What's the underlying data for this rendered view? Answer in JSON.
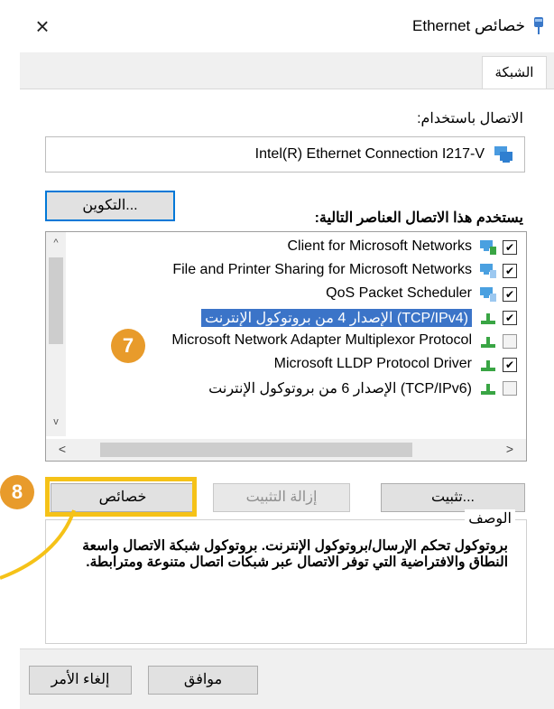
{
  "window": {
    "title": "خصائص Ethernet",
    "close_glyph": "×"
  },
  "tabs": [
    {
      "label": "الشبكة"
    }
  ],
  "connect": {
    "label": "الاتصال باستخدام:",
    "adapter_name": "Intel(R) Ethernet Connection I217-V",
    "configure_button": "التكوين..."
  },
  "items_label": "يستخدم هذا الاتصال العناصر التالية:",
  "items": [
    {
      "label": "Client for Microsoft Networks",
      "checked": true,
      "check_glyph": "✔",
      "icon": "network-client-icon"
    },
    {
      "label": "File and Printer Sharing for Microsoft Networks",
      "checked": true,
      "check_glyph": "✔",
      "icon": "network-service-icon"
    },
    {
      "label": "QoS Packet Scheduler",
      "checked": true,
      "check_glyph": "✔",
      "icon": "network-service-icon"
    },
    {
      "label": "(TCP/IPv4) الإصدار 4 من بروتوكول الإنترنت",
      "checked": true,
      "check_glyph": "✔",
      "icon": "protocol-icon",
      "selected": true
    },
    {
      "label": "Microsoft Network Adapter Multiplexor Protocol",
      "checked": false,
      "check_glyph": "",
      "icon": "protocol-icon"
    },
    {
      "label": "Microsoft LLDP Protocol Driver",
      "checked": true,
      "check_glyph": "✔",
      "icon": "protocol-icon"
    },
    {
      "label": "(TCP/IPv6) الإصدار 6 من بروتوكول الإنترنت",
      "checked": false,
      "check_glyph": "",
      "icon": "protocol-icon"
    }
  ],
  "list_scroll": {
    "up": "^",
    "down": "v",
    "left": "<",
    "right": ">"
  },
  "buttons": {
    "install": "تثبيت...",
    "uninstall": "إزالة التثبيت",
    "properties": "خصائص"
  },
  "description": {
    "legend": "الوصف",
    "text": "بروتوكول تحكم الإرسال/بروتوكول الإنترنت. بروتوكول شبكة الاتصال واسعة النطاق والافتراضية التي توفر الاتصال عبر شبكات اتصال متنوعة ومترابطة."
  },
  "footer": {
    "ok": "موافق",
    "cancel": "إلغاء الأمر"
  },
  "annotations": {
    "step_a": "7",
    "step_b": "8"
  },
  "colors": {
    "selection": "#3b74c8",
    "badge": "#e89b2b",
    "highlight_frame": "#f5c218"
  }
}
